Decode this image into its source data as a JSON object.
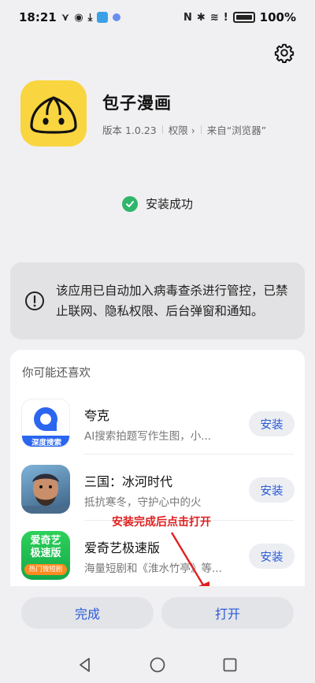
{
  "status_bar": {
    "time": "18:21",
    "battery": "100%"
  },
  "app": {
    "name": "包子漫画",
    "version": "版本 1.0.23",
    "permissions": "权限",
    "source": "来自“浏览器”"
  },
  "install_status": "安装成功",
  "notice": "该应用已自动加入病毒查杀进行管控，已禁止联网、隐私权限、后台弹窗和通知。",
  "recommend": {
    "title": "你可能还喜欢",
    "items": [
      {
        "name": "夸克",
        "desc": "AI搜索拍题写作生图，小...",
        "button": "安装",
        "badge": "深度搜索"
      },
      {
        "name": "三国：冰河时代",
        "desc": "抵抗寒冬，守护心中的火",
        "button": "安装"
      },
      {
        "name": "爱奇艺极速版",
        "desc": "海量短剧和《淮水竹亭》等...",
        "button": "安装",
        "badge_line1": "爱奇艺",
        "badge_line2": "极速版",
        "badge_sub": "热门微短剧"
      }
    ]
  },
  "annotation": "安装完成后点击打开",
  "buttons": {
    "done": "完成",
    "open": "打开"
  },
  "colors": {
    "accent": "#2a5bd7",
    "success": "#2fb66b",
    "annotation": "#e02020",
    "app_icon": "#f9d540"
  }
}
